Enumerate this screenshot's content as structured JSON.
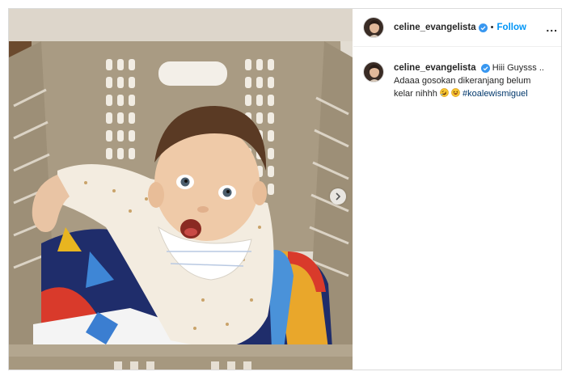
{
  "header": {
    "username": "celine_evangelista",
    "separator": "•",
    "follow_label": "Follow",
    "more_label": "..."
  },
  "caption": {
    "username": "celine_evangelista",
    "text_line1": "Hiii Guysss ..",
    "text_line2": "Adaaa gosokan dikeranjang belum",
    "text_line3": "kelar nihhh",
    "hashtag": "#koalewismiguel",
    "emojis": [
      "rolling-on-floor-laughing-emoji",
      "grinning-squinting-emoji"
    ]
  },
  "media": {
    "description_icon": "photo",
    "carousel_next_icon": "chevron-right-icon"
  },
  "colors": {
    "link_blue": "#0095f6",
    "hashtag_blue": "#00376b",
    "verified_blue": "#3897f0",
    "basket_tan": "#a89a82"
  }
}
